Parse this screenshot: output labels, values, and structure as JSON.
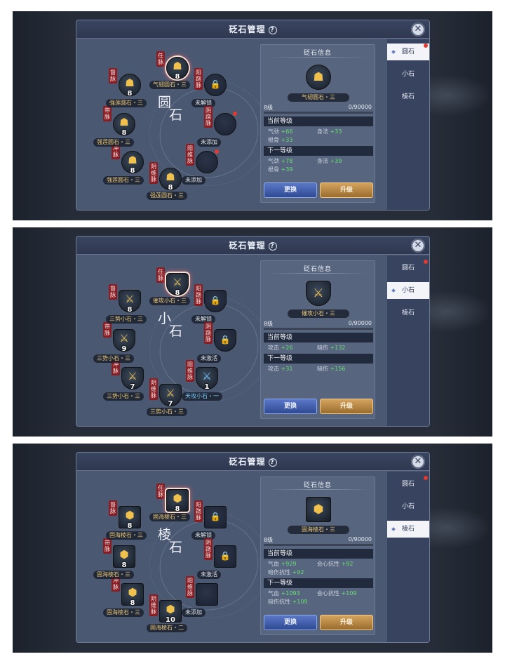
{
  "screens": [
    {
      "title": "砭石管理",
      "center": [
        "圆",
        "石"
      ],
      "gem_style": "round",
      "info": {
        "title": "砭石信息",
        "name": "气韧圆石・三",
        "icon": "hex-crest-icon",
        "level": "8级",
        "exp": "0/90000",
        "exp_fraction": 0,
        "current": "当前等级",
        "next": "下一等级",
        "cur_stats": [
          [
            "气劲",
            "+66"
          ],
          [
            "身法",
            "+33"
          ],
          [
            "根骨",
            "+33"
          ]
        ],
        "next_stats": [
          [
            "气劲",
            "+78"
          ],
          [
            "身法",
            "+39"
          ],
          [
            "根骨",
            "+39"
          ]
        ]
      },
      "buttons": {
        "swap": "更换",
        "upgrade": "升级"
      },
      "tabs": [
        {
          "label": "圆石",
          "active": true,
          "dot": true
        },
        {
          "label": "小石",
          "active": false,
          "dot": false
        },
        {
          "label": "棱石",
          "active": false,
          "dot": false
        }
      ],
      "slots": [
        {
          "tag": "任脉",
          "label": "气韧圆石・三",
          "level": "8",
          "state": "gem",
          "color": "g",
          "sel": true,
          "dot": false
        },
        {
          "tag": "阳跷脉",
          "label": "未解锁",
          "level": "",
          "state": "lock",
          "color": "w",
          "sel": false,
          "dot": false
        },
        {
          "tag": "阴跷脉",
          "label": "未添加",
          "level": "",
          "state": "empty",
          "color": "w",
          "sel": false,
          "dot": true
        },
        {
          "tag": "阳维脉",
          "label": "未添加",
          "level": "",
          "state": "empty",
          "color": "w",
          "sel": false,
          "dot": true
        },
        {
          "tag": "阴维脉",
          "label": "强莲圆石・三",
          "level": "8",
          "state": "gem",
          "color": "g",
          "sel": false,
          "dot": false
        },
        {
          "tag": "冲脉",
          "label": "强莲圆石・三",
          "level": "8",
          "state": "gem",
          "color": "g",
          "sel": false,
          "dot": false
        },
        {
          "tag": "带脉",
          "label": "强莲圆石・三",
          "level": "8",
          "state": "gem",
          "color": "g",
          "sel": false,
          "dot": false
        },
        {
          "tag": "督脉",
          "label": "强莲圆石・三",
          "level": "8",
          "state": "gem",
          "color": "g",
          "sel": false,
          "dot": false
        }
      ]
    },
    {
      "title": "砭石管理",
      "center": [
        "小",
        "石"
      ],
      "gem_style": "shield",
      "info": {
        "title": "砭石信息",
        "name": "催攻小石・三",
        "icon": "crossed-swords-icon",
        "level": "8级",
        "exp": "0/90000",
        "exp_fraction": 0,
        "current": "当前等级",
        "next": "下一等级",
        "cur_stats": [
          [
            "攻击",
            "+26"
          ],
          [
            "暗伤",
            "+132"
          ]
        ],
        "next_stats": [
          [
            "攻击",
            "+31"
          ],
          [
            "暗伤",
            "+156"
          ]
        ]
      },
      "buttons": {
        "swap": "更换",
        "upgrade": "升级"
      },
      "tabs": [
        {
          "label": "圆石",
          "active": false,
          "dot": true
        },
        {
          "label": "小石",
          "active": true,
          "dot": false
        },
        {
          "label": "棱石",
          "active": false,
          "dot": false
        }
      ],
      "slots": [
        {
          "tag": "任脉",
          "label": "催攻小石・三",
          "level": "8",
          "state": "gem",
          "color": "g",
          "sel": true,
          "dot": false
        },
        {
          "tag": "阳跷脉",
          "label": "未解锁",
          "level": "",
          "state": "lock",
          "color": "w",
          "sel": false,
          "dot": false
        },
        {
          "tag": "阴跷脉",
          "label": "未激活",
          "level": "",
          "state": "lock",
          "color": "w",
          "sel": false,
          "dot": false
        },
        {
          "tag": "阳维脉",
          "label": "天攻小石・一",
          "level": "1",
          "state": "gem",
          "color": "b",
          "sel": false,
          "dot": false
        },
        {
          "tag": "阴维脉",
          "label": "三势小石・三",
          "level": "7",
          "state": "gem",
          "color": "g",
          "sel": false,
          "dot": false
        },
        {
          "tag": "冲脉",
          "label": "三势小石・三",
          "level": "7",
          "state": "gem",
          "color": "g",
          "sel": false,
          "dot": false
        },
        {
          "tag": "带脉",
          "label": "三势小石・三",
          "level": "9",
          "state": "gem",
          "color": "g",
          "sel": false,
          "dot": false
        },
        {
          "tag": "督脉",
          "label": "三势小石・三",
          "level": "8",
          "state": "gem",
          "color": "g",
          "sel": false,
          "dot": false
        }
      ]
    },
    {
      "title": "砭石管理",
      "center": [
        "棱",
        "石"
      ],
      "gem_style": "square",
      "info": {
        "title": "砭石信息",
        "name": "固海棱石・三",
        "icon": "emblem-icon",
        "level": "8级",
        "exp": "0/90000",
        "exp_fraction": 0,
        "current": "当前等级",
        "next": "下一等级",
        "cur_stats": [
          [
            "气血",
            "+929"
          ],
          [
            "会心抗性",
            "+92"
          ],
          [
            "暗伤抗性",
            "+92"
          ]
        ],
        "next_stats": [
          [
            "气血",
            "+1093"
          ],
          [
            "会心抗性",
            "+109"
          ],
          [
            "暗伤抗性",
            "+109"
          ]
        ]
      },
      "buttons": {
        "swap": "更换",
        "upgrade": "升级"
      },
      "tabs": [
        {
          "label": "圆石",
          "active": false,
          "dot": true
        },
        {
          "label": "小石",
          "active": false,
          "dot": false
        },
        {
          "label": "棱石",
          "active": true,
          "dot": false
        }
      ],
      "slots": [
        {
          "tag": "任脉",
          "label": "固海棱石・三",
          "level": "8",
          "state": "gem",
          "color": "g",
          "sel": true,
          "dot": false
        },
        {
          "tag": "阳跷脉",
          "label": "未解锁",
          "level": "",
          "state": "lock",
          "color": "w",
          "sel": false,
          "dot": false
        },
        {
          "tag": "阴跷脉",
          "label": "未激活",
          "level": "",
          "state": "lock",
          "color": "w",
          "sel": false,
          "dot": false
        },
        {
          "tag": "阳维脉",
          "label": "未添加",
          "level": "",
          "state": "empty",
          "color": "w",
          "sel": false,
          "dot": false
        },
        {
          "tag": "阴维脉",
          "label": "固海棱石・二",
          "level": "10",
          "state": "gem",
          "color": "g",
          "sel": false,
          "dot": false
        },
        {
          "tag": "冲脉",
          "label": "固海棱石・三",
          "level": "8",
          "state": "gem",
          "color": "g",
          "sel": false,
          "dot": false
        },
        {
          "tag": "带脉",
          "label": "固海棱石・三",
          "level": "8",
          "state": "gem",
          "color": "g",
          "sel": false,
          "dot": false
        },
        {
          "tag": "督脉",
          "label": "固海棱石・三",
          "level": "8",
          "state": "gem",
          "color": "g",
          "sel": false,
          "dot": false
        }
      ]
    }
  ]
}
